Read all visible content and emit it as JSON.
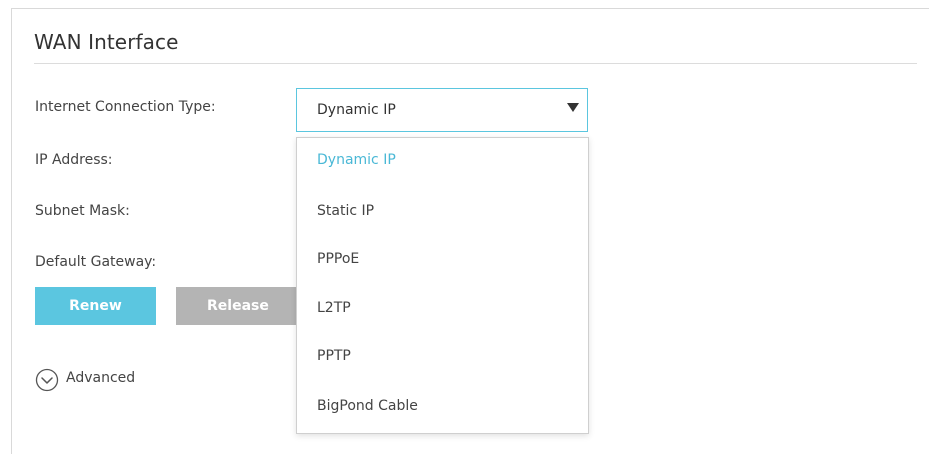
{
  "section": {
    "title": "WAN Interface"
  },
  "fields": {
    "connection_type_label": "Internet Connection Type:",
    "ip_address_label": "IP Address:",
    "subnet_mask_label": "Subnet Mask:",
    "default_gateway_label": "Default Gateway:"
  },
  "connection_select": {
    "value": "Dynamic IP",
    "options": [
      "Dynamic IP",
      "Static IP",
      "PPPoE",
      "L2TP",
      "PPTP",
      "BigPond Cable"
    ],
    "selected_index": 0
  },
  "buttons": {
    "renew": "Renew",
    "release": "Release"
  },
  "advanced": {
    "label": "Advanced",
    "icon": "chevron-down-circle-icon"
  },
  "colors": {
    "accent": "#5bc6e0",
    "selected_option": "#4ab8d6",
    "disabled_button": "#b4b4b4"
  }
}
